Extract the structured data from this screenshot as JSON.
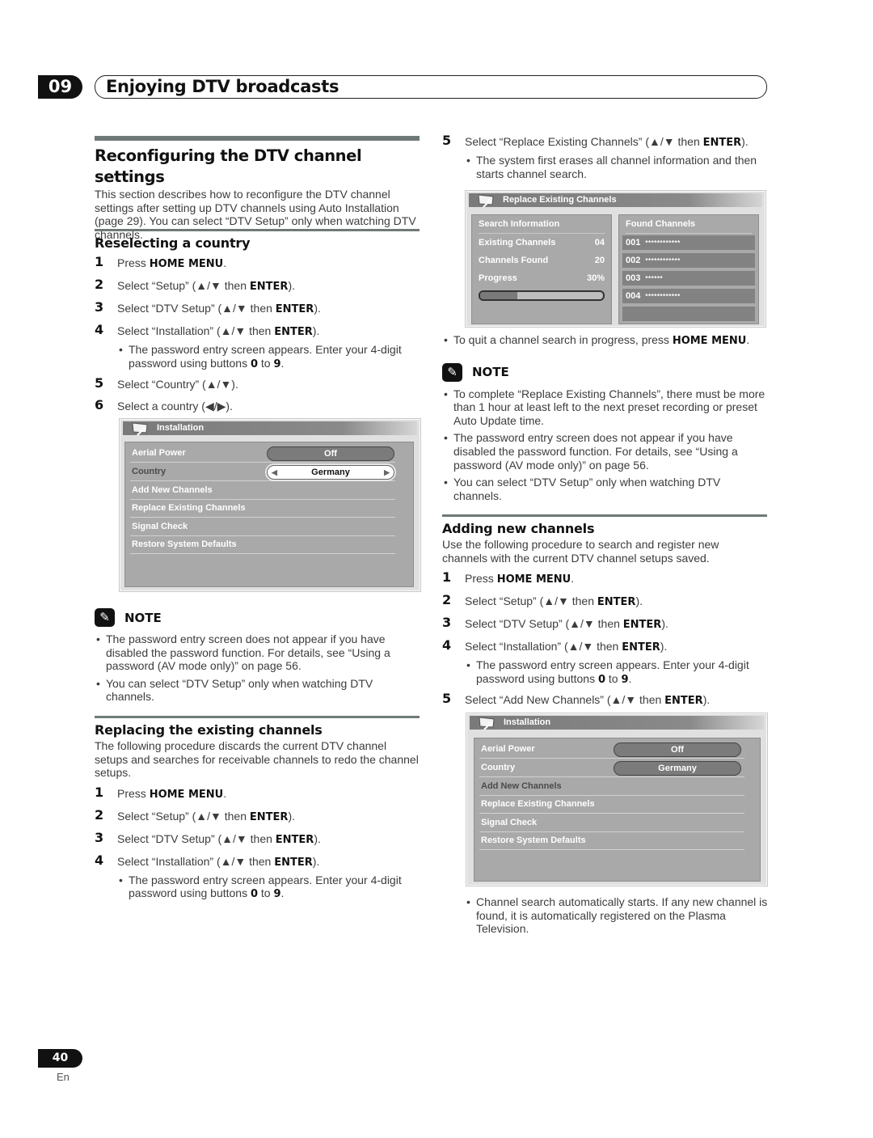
{
  "chapter": {
    "number": "09",
    "title": "Enjoying DTV broadcasts"
  },
  "main_section": {
    "title": "Reconfiguring the DTV channel settings",
    "intro": "This section describes how to reconfigure the DTV channel settings after setting up DTV channels using Auto Installation (page 29). You can select “DTV Setup” only when watching DTV channels."
  },
  "reselect_country": {
    "title": "Reselecting a country",
    "steps": [
      {
        "num": "1",
        "pre": "Press ",
        "bold": "HOME MENU",
        "post": "."
      },
      {
        "num": "2",
        "pre": "Select “Setup” (▲/▼ then ",
        "bold": "ENTER",
        "post": ")."
      },
      {
        "num": "3",
        "pre": "Select “DTV Setup” (▲/▼ then ",
        "bold": "ENTER",
        "post": ")."
      },
      {
        "num": "4",
        "pre": "Select “Installation” (▲/▼ then ",
        "bold": "ENTER",
        "post": ")."
      },
      {
        "num": "5",
        "pre": "Select  “Country” (▲/▼).",
        "bold": "",
        "post": ""
      },
      {
        "num": "6",
        "pre": "Select a country (◀/▶).",
        "bold": "",
        "post": ""
      }
    ],
    "step4_bullet": {
      "pre": "The password entry screen appears. Enter your 4-digit password using buttons ",
      "b1": "0",
      "mid": " to ",
      "b2": "9",
      "post": "."
    },
    "screen": {
      "title": "Installation",
      "rows": [
        {
          "label": "Aerial Power",
          "value": "Off"
        },
        {
          "label": "Country",
          "value": "Germany",
          "left_arrow": "◀",
          "right_arrow": "▶"
        },
        {
          "label": "Add New Channels"
        },
        {
          "label": "Replace Existing Channels"
        },
        {
          "label": "Signal Check"
        },
        {
          "label": "Restore System Defaults"
        }
      ]
    },
    "note": {
      "label": "NOTE",
      "bullets": [
        "The password entry screen does not appear if you have disabled the password function. For details, see “Using a password (AV mode only)” on page 56.",
        "You can select “DTV Setup” only when watching DTV channels."
      ]
    }
  },
  "replace_channels": {
    "title": "Replacing the existing channels",
    "intro": "The following procedure discards the current DTV channel setups and searches for receivable channels to redo the channel setups.",
    "steps": [
      {
        "num": "1",
        "pre": "Press ",
        "bold": "HOME MENU",
        "post": "."
      },
      {
        "num": "2",
        "pre": "Select “Setup” (▲/▼ then ",
        "bold": "ENTER",
        "post": ")."
      },
      {
        "num": "3",
        "pre": "Select “DTV Setup” (▲/▼ then ",
        "bold": "ENTER",
        "post": ")."
      },
      {
        "num": "4",
        "pre": "Select “Installation” (▲/▼ then ",
        "bold": "ENTER",
        "post": ")."
      },
      {
        "num": "5",
        "pre": "Select “Replace Existing Channels” (▲/▼ then ",
        "bold": "ENTER",
        "post": ")."
      }
    ],
    "step4_bullet": {
      "pre": "The password entry screen appears. Enter your 4-digit password using buttons ",
      "b1": "0",
      "mid": " to ",
      "b2": "9",
      "post": "."
    },
    "step5_bullet": "The system first erases all channel information and then starts channel search.",
    "screen": {
      "title": "Replace Existing Channels",
      "search_header": "Search Information",
      "found_header": "Found Channels",
      "info": [
        {
          "label": "Existing Channels",
          "value": "04"
        },
        {
          "label": "Channels Found",
          "value": "20"
        },
        {
          "label": "Progress",
          "value": "30%"
        }
      ],
      "progress_fraction": 0.3,
      "found": [
        {
          "num": "001",
          "name": "************"
        },
        {
          "num": "002",
          "name": "************"
        },
        {
          "num": "003",
          "name": "******"
        },
        {
          "num": "004",
          "name": "************"
        }
      ]
    },
    "quit_bullet": {
      "pre": "To quit a channel search in progress, press ",
      "bold": "HOME MENU",
      "post": "."
    },
    "note": {
      "label": "NOTE",
      "bullets": [
        "To complete “Replace Existing Channels”, there must be more than 1 hour at least left to the next preset recording or preset Auto Update time.",
        "The password entry screen does not appear if you have disabled the password function. For details, see “Using a password (AV mode only)” on page 56.",
        "You can select “DTV Setup” only when watching DTV channels."
      ]
    }
  },
  "add_channels": {
    "title": "Adding new channels",
    "intro": "Use the following procedure to search and register new channels with the current DTV channel setups saved.",
    "steps": [
      {
        "num": "1",
        "pre": "Press ",
        "bold": "HOME MENU",
        "post": "."
      },
      {
        "num": "2",
        "pre": "Select “Setup” (▲/▼ then ",
        "bold": "ENTER",
        "post": ")."
      },
      {
        "num": "3",
        "pre": "Select “DTV Setup” (▲/▼ then ",
        "bold": "ENTER",
        "post": ")."
      },
      {
        "num": "4",
        "pre": "Select “Installation” (▲/▼ then ",
        "bold": "ENTER",
        "post": ")."
      },
      {
        "num": "5",
        "pre": "Select  “Add New Channels” (▲/▼ then ",
        "bold": "ENTER",
        "post": ")."
      }
    ],
    "step4_bullet": {
      "pre": "The password entry screen appears. Enter your 4-digit password using buttons ",
      "b1": "0",
      "mid": " to ",
      "b2": "9",
      "post": "."
    },
    "screen": {
      "title": "Installation",
      "rows": [
        {
          "label": "Aerial Power",
          "value": "Off"
        },
        {
          "label": "Country",
          "value": "Germany"
        },
        {
          "label": "Add New Channels"
        },
        {
          "label": "Replace Existing Channels"
        },
        {
          "label": "Signal Check"
        },
        {
          "label": "Restore System Defaults"
        }
      ]
    },
    "final_bullet": "Channel search automatically starts. If any new channel is found, it is automatically registered on the Plasma Television."
  },
  "footer": {
    "page": "40",
    "lang": "En"
  }
}
